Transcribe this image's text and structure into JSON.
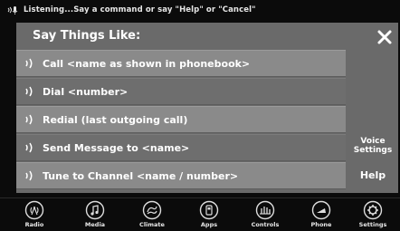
{
  "status": {
    "text": "Listening...Say a command or say \"Help\" or \"Cancel\""
  },
  "panel": {
    "title": "Say Things Like:",
    "commands": [
      {
        "label": "Call <name as shown in phonebook>"
      },
      {
        "label": "Dial <number>"
      },
      {
        "label": "Redial (last outgoing call)"
      },
      {
        "label": "Send Message to <name>"
      },
      {
        "label": "Tune to Channel <name / number>"
      }
    ],
    "voice_settings_line1": "Voice",
    "voice_settings_line2": "Settings",
    "help_label": "Help"
  },
  "nav": {
    "items": [
      {
        "label": "Radio",
        "icon": "radio-icon"
      },
      {
        "label": "Media",
        "icon": "media-icon"
      },
      {
        "label": "Climate",
        "icon": "climate-icon"
      },
      {
        "label": "Apps",
        "icon": "apps-icon"
      },
      {
        "label": "Controls",
        "icon": "controls-icon"
      },
      {
        "label": "Phone",
        "icon": "phone-icon"
      },
      {
        "label": "Settings",
        "icon": "settings-icon"
      }
    ]
  },
  "colors": {
    "panel": "#6a6a6a",
    "row_light": "#8a8a8a",
    "row_dark": "#6e6e6e",
    "background": "#0b0b0b",
    "text": "#ffffff"
  }
}
